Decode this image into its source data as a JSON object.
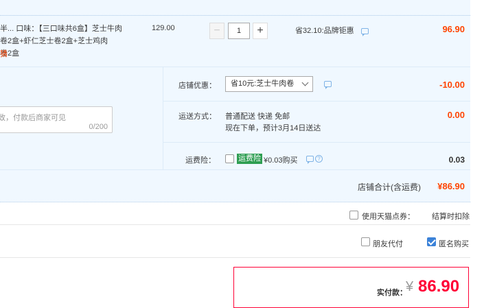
{
  "item": {
    "name_line1": "半...  口味：【三口味共6盒】芝士牛肉",
    "name_line2": "卷2盒+虾仁芝士卷2盒+芝士鸡肉",
    "name_line3": "卷2盒",
    "variant_mark": "猜",
    "price": "129.00",
    "quantity": "1",
    "promo": "省32.10:品牌钜惠",
    "subtotal": "96.90",
    "icons": {
      "minus": "minus-icon",
      "plus": "plus-icon",
      "chat": "chat-bubble-icon"
    }
  },
  "shop_discount": {
    "label": "店铺优惠：",
    "selected": "省10元:芝士牛肉卷",
    "amount": "-10.00"
  },
  "message": {
    "placeholder": "致，付款后商家可见",
    "counter": "0/200"
  },
  "shipping": {
    "label": "运送方式：",
    "method": "普通配送 快递 免邮",
    "note": "现在下单，预计3月14日送达",
    "fee": "0.00"
  },
  "insurance": {
    "label": "运费险：",
    "badge": "运费险",
    "price_text": "¥0.03购买",
    "amount": "0.03"
  },
  "shop_total": {
    "label": "店铺合计(含运费)",
    "amount": "¥86.90"
  },
  "tmall_points": {
    "label": "使用天猫点券：",
    "note": "结算时扣除"
  },
  "options": {
    "friend_pay": "朋友代付",
    "anonymous": "匿名购买"
  },
  "payment": {
    "label": "实付款：",
    "symbol": "¥",
    "amount": "86.90"
  },
  "colors": {
    "accent_red": "#ff0036",
    "price_red": "#f40",
    "section_bg": "#f0f8ff",
    "checkbox_blue": "#3b82d8",
    "insurance_green": "#2e9e52"
  }
}
